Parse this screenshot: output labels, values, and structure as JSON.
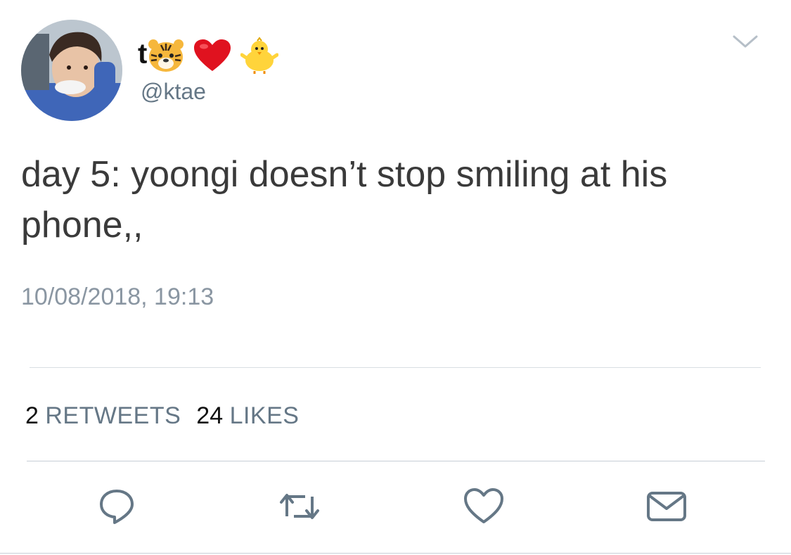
{
  "tweet": {
    "display_name": "t",
    "display_name_emojis": [
      "tiger-face",
      "red-heart",
      "baby-chick"
    ],
    "handle": "@ktae",
    "text": "day 5: yoongi doesn’t stop smiling at his phone,,",
    "timestamp": "10/08/2018, 19:13"
  },
  "stats": {
    "retweets_count": "2",
    "retweets_label": "RETWEETS",
    "likes_count": "24",
    "likes_label": "LIKES"
  },
  "actions": {
    "reply_icon": "reply-icon",
    "retweet_icon": "retweet-icon",
    "like_icon": "heart-icon",
    "dm_icon": "envelope-icon"
  },
  "colors": {
    "text": "#3a3a3a",
    "secondary": "#657786",
    "icon": "#657786",
    "divider": "#d9dee3"
  }
}
